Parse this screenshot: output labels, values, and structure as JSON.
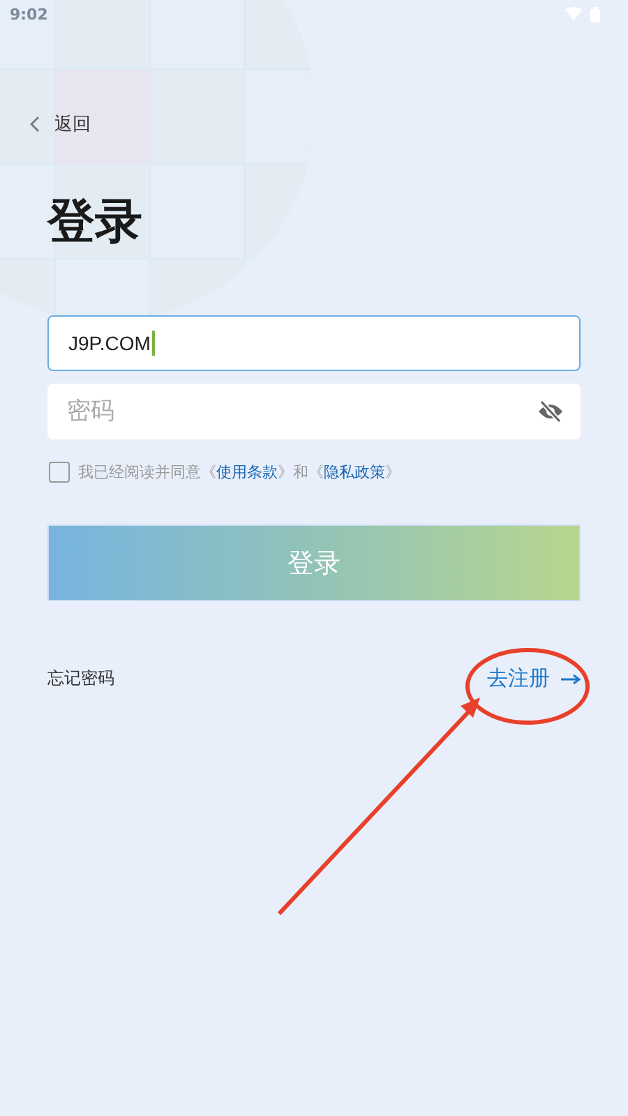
{
  "status_bar": {
    "time": "9:02"
  },
  "back": {
    "label": "返回"
  },
  "title": "登录",
  "username": {
    "value": "J9P.COM",
    "focused": true
  },
  "password": {
    "placeholder": "密码",
    "visible": false
  },
  "agreement": {
    "checked": false,
    "parts": [
      {
        "kind": "text",
        "text": "我已经阅读并同意《"
      },
      {
        "kind": "link",
        "text": "使用条款"
      },
      {
        "kind": "text",
        "text": "》和《"
      },
      {
        "kind": "link",
        "text": "隐私政策"
      },
      {
        "kind": "text",
        "text": "》"
      }
    ]
  },
  "login_button": {
    "label": "登录"
  },
  "forgot_password": {
    "label": "忘记密码"
  },
  "register": {
    "label": "去注册"
  }
}
